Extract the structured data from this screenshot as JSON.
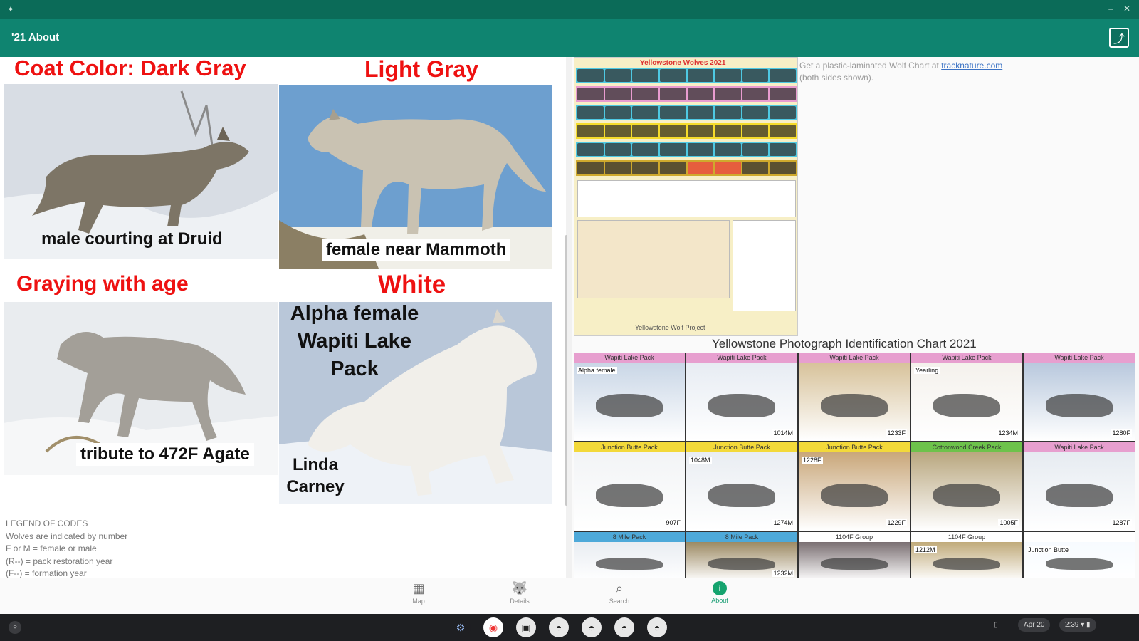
{
  "topbar": {
    "title": "'21 About"
  },
  "left_panel": {
    "headings": {
      "coat_color": "Coat Color:  Dark Gray",
      "light_gray": "Light Gray",
      "graying": "Graying with age",
      "white": "White"
    },
    "captions": {
      "dark_gray": "male courting at Druid",
      "light_gray": "female near Mammoth",
      "graying": "tribute to 472F Agate",
      "white_line1": "Alpha female",
      "white_line2": "Wapiti Lake",
      "white_line3": "Pack",
      "credit_line1": "Linda",
      "credit_line2": "Carney"
    },
    "legend": [
      "LEGEND OF CODES",
      "Wolves are indicated by number",
      "F or M = female or male",
      "(R--) = pack restoration year",
      "(F--) = formation year"
    ]
  },
  "right_panel": {
    "small_chart_title": "Yellowstone Wolves 2021",
    "note_line1_prefix": "Get a plastic-laminated Wolf Chart at ",
    "note_link": "tracknature.com",
    "note_line2": "(both sides shown).",
    "chart_title": "Yellowstone Photograph Identification Chart 2021",
    "cells": [
      {
        "header": "Wapiti Lake Pack",
        "label": "Alpha female",
        "code": "",
        "color": "#e79fcf"
      },
      {
        "header": "Wapiti Lake Pack",
        "label": "",
        "code": "1014M",
        "color": "#e79fcf"
      },
      {
        "header": "Wapiti Lake Pack",
        "label": "",
        "code": "1233F",
        "color": "#e79fcf"
      },
      {
        "header": "Wapiti Lake Pack",
        "label": "Yearling",
        "code": "1234M",
        "color": "#e79fcf"
      },
      {
        "header": "Wapiti Lake Pack",
        "label": "",
        "code": "1280F",
        "color": "#e79fcf"
      },
      {
        "header": "Junction Butte Pack",
        "label": "",
        "code": "907F",
        "color": "#f3d93a"
      },
      {
        "header": "Junction Butte Pack",
        "label": "1048M",
        "code": "1274M",
        "color": "#f3d93a"
      },
      {
        "header": "Junction Butte Pack",
        "label": "1228F",
        "code": "1229F",
        "color": "#f3d93a"
      },
      {
        "header": "Cottonwood Creek Pack",
        "label": "",
        "code": "1005F",
        "color": "#6dc24b"
      },
      {
        "header": "Wapiti Lake Pack",
        "label": "",
        "code": "1287F",
        "color": "#e79fcf"
      },
      {
        "header": "8 Mile Pack",
        "label": "",
        "code": "",
        "color": "#4ea9d9"
      },
      {
        "header": "8 Mile Pack",
        "label": "",
        "code": "1232M",
        "color": "#4ea9d9"
      },
      {
        "header": "1104F Group",
        "label": "",
        "code": "",
        "color": "#ffffff"
      },
      {
        "header": "1104F Group",
        "label": "1212M",
        "code": "",
        "color": "#ffffff"
      },
      {
        "header": "",
        "label": "Junction Butte",
        "code": "",
        "color": "#ffffff"
      }
    ]
  },
  "bottom_nav": [
    {
      "label": "Map",
      "icon": "map-icon"
    },
    {
      "label": "Details",
      "icon": "wolf-icon"
    },
    {
      "label": "Search",
      "icon": "search-icon"
    },
    {
      "label": "About",
      "icon": "info-icon"
    }
  ],
  "shelf": {
    "date": "Apr 20",
    "time": "2:39"
  }
}
